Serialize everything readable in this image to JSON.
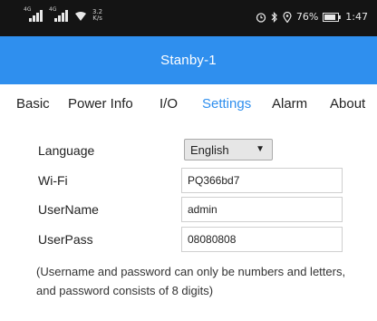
{
  "status_bar": {
    "sim1_tag": "4G",
    "sim2_tag": "4G",
    "net_speed_value": "3.2",
    "net_speed_unit": "K/s",
    "battery_percent": "76%",
    "time": "1:47",
    "icons": [
      "signal-icon",
      "signal-icon",
      "wifi-icon",
      "alarm-icon",
      "bluetooth-icon",
      "location-icon",
      "battery-icon"
    ]
  },
  "app_bar": {
    "title": "Stanby-1",
    "color": "#2f8fee"
  },
  "tabs": [
    {
      "label": "Basic",
      "active": false
    },
    {
      "label": "Power Info",
      "active": false
    },
    {
      "label": "I/O",
      "active": false
    },
    {
      "label": "Settings",
      "active": true
    },
    {
      "label": "Alarm",
      "active": false
    },
    {
      "label": "About",
      "active": false
    }
  ],
  "settings": {
    "language_label": "Language",
    "language_value": "English",
    "wifi_label": "Wi-Fi",
    "wifi_value": "PQ366bd7",
    "username_label": "UserName",
    "username_value": "admin",
    "userpass_label": "UserPass",
    "userpass_value": "08080808",
    "note": "(Username and password can only be numbers and letters, and password consists of 8 digits)"
  }
}
